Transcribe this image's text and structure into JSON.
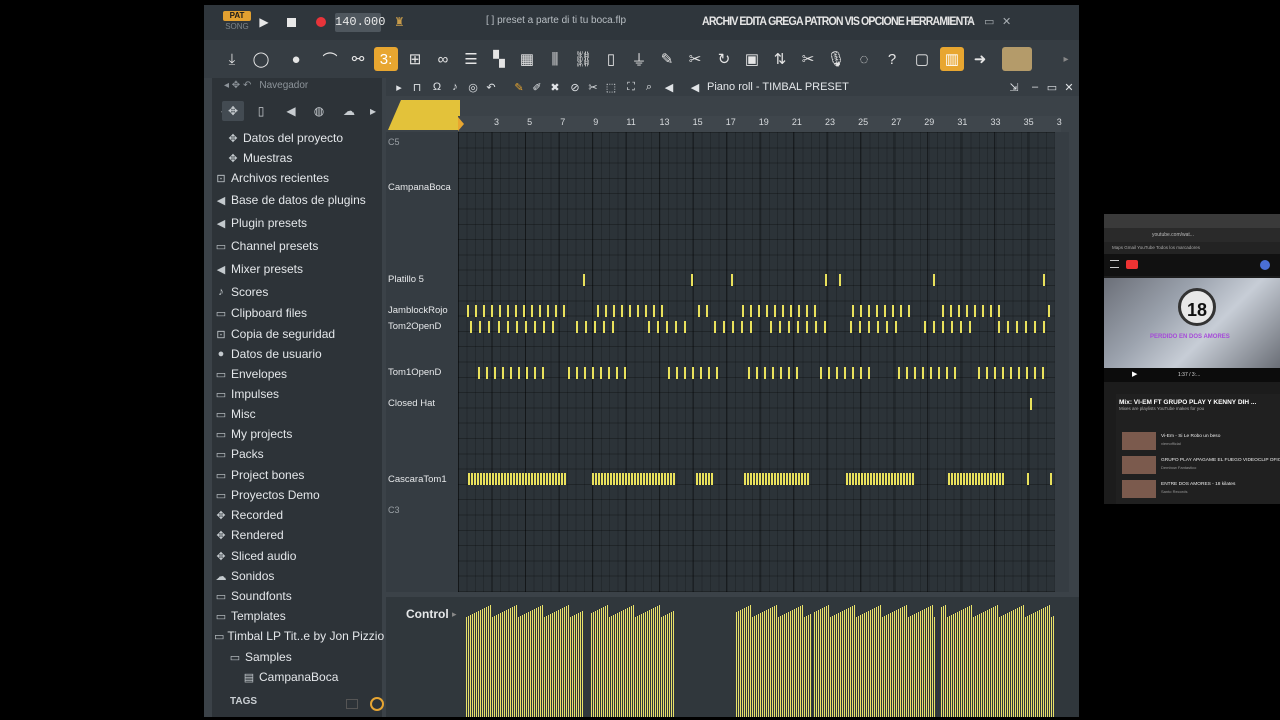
{
  "titlebar": {
    "pat_label": "PAT",
    "song_label": "SONG",
    "tempo": "140.000",
    "hint": "[  ] preset a parte di ti tu boca.flp",
    "menu": [
      "ARCHIV",
      "EDITA",
      "GREGA",
      "PATRON",
      "VIS",
      "OPCIONE",
      "HERRAMIENTA"
    ]
  },
  "browser": {
    "title": "Navegador",
    "items": [
      {
        "label": "Datos del proyecto",
        "icon": "plug-icon"
      },
      {
        "label": "Muestras",
        "icon": "plug-icon"
      },
      {
        "label": "Archivos recientes",
        "icon": "folder-clock-icon"
      },
      {
        "label": "Base de datos de plugins",
        "icon": "speaker-icon"
      },
      {
        "label": "Plugin presets",
        "icon": "speaker-icon"
      },
      {
        "label": "Channel presets",
        "icon": "folder-icon"
      },
      {
        "label": "Mixer presets",
        "icon": "speaker-icon"
      },
      {
        "label": "Scores",
        "icon": "note-icon"
      },
      {
        "label": "Clipboard files",
        "icon": "folder-icon"
      },
      {
        "label": "Copia de seguridad",
        "icon": "folder-clock-icon"
      },
      {
        "label": "Datos de usuario",
        "icon": "user-icon"
      },
      {
        "label": "Envelopes",
        "icon": "folder-icon"
      },
      {
        "label": "Impulses",
        "icon": "folder-icon"
      },
      {
        "label": "Misc",
        "icon": "folder-icon"
      },
      {
        "label": "My projects",
        "icon": "folder-icon"
      },
      {
        "label": "Packs",
        "icon": "folder-icon"
      },
      {
        "label": "Project bones",
        "icon": "folder-icon"
      },
      {
        "label": "Proyectos Demo",
        "icon": "folder-icon"
      },
      {
        "label": "Recorded",
        "icon": "plug-icon"
      },
      {
        "label": "Rendered",
        "icon": "plug-icon"
      },
      {
        "label": "Sliced audio",
        "icon": "plug-icon"
      },
      {
        "label": "Sonidos",
        "icon": "cloud-icon"
      },
      {
        "label": "Soundfonts",
        "icon": "folder-icon"
      },
      {
        "label": "Templates",
        "icon": "folder-icon"
      },
      {
        "label": "Timbal LP Tit..e by Jon Pizzio",
        "icon": "folder-icon"
      },
      {
        "label": "Samples",
        "icon": "folder-icon"
      },
      {
        "label": "CampanaBoca",
        "icon": "wave-icon"
      }
    ],
    "tags_label": "TAGS"
  },
  "piano_roll": {
    "title": "Piano roll - TIMBAL PRESET",
    "ruler_ticks": [
      "3",
      "5",
      "7",
      "9",
      "11",
      "13",
      "15",
      "17",
      "19",
      "21",
      "23",
      "25",
      "27",
      "29",
      "31",
      "33",
      "35",
      "3"
    ],
    "key_labels": [
      {
        "label": "C5",
        "dim": true
      },
      {
        "label": "CampanaBoca",
        "dim": false
      },
      {
        "label": "Platillo 5",
        "dim": false
      },
      {
        "label": "JamblockRojo",
        "dim": false
      },
      {
        "label": "Tom2OpenD",
        "dim": false
      },
      {
        "label": "Tom1OpenD",
        "dim": false
      },
      {
        "label": "Closed Hat",
        "dim": false
      },
      {
        "label": "CascaraTom1",
        "dim": false
      },
      {
        "label": "C3",
        "dim": true
      }
    ],
    "control_label": "Control"
  },
  "youtube": {
    "url": "youtube.com/wat...",
    "bookmarks": "Maps   Gmail   YouTube                                  Todos los marcadores",
    "badge": "18",
    "video_title": "PERDIDO EN DOS AMORES",
    "time": "1:37 / 3:...",
    "mix_title": "Mix: VI-EM FT GRUPO PLAY Y KENNY DIH ...",
    "mix_sub": "Mixes are playlists YouTube makes for you",
    "items": [
      {
        "title": "Vi-Em - Si Le Robo un beso",
        "channel": "viemofficial"
      },
      {
        "title": "GRUPO PLAY APAGAME EL FUEGO\nVIDEOCLIP OFICIAL HD",
        "channel": "Dembow Fantastico"
      },
      {
        "title": "ENTRE DOS AMORES - 18 kilates",
        "channel": "Santo Records"
      }
    ]
  }
}
